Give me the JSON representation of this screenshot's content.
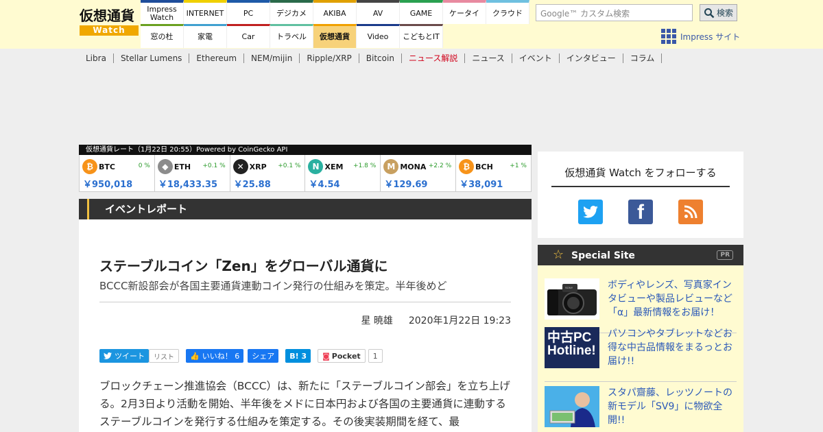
{
  "header": {
    "logo_top": "仮想通貨",
    "logo_bottom": "Watch",
    "nav_row1": [
      "Impress Watch",
      "INTERNET",
      "PC",
      "デジカメ",
      "AKIBA",
      "AV",
      "GAME",
      "ケータイ",
      "クラウド"
    ],
    "nav_row2": [
      "窓の杜",
      "家電",
      "Car",
      "トラベル",
      "仮想通貨",
      "Video",
      "こどもとIT"
    ],
    "nav_row1_colors": [
      "#1f4d9a",
      "#f0d000",
      "#1e5aa8",
      "#2a6a4a",
      "#e0a000",
      "#444444",
      "#2aa050",
      "#e88aa0",
      "#6fc0e0"
    ],
    "nav_row2_colors": [
      "#6aa020",
      "#40a0d0",
      "#c02020",
      "#60c0a0",
      "#f0a000",
      "#1a3a8a",
      "#6a4a4a"
    ],
    "search_placeholder": "Google™ カスタム検索",
    "search_button": "検索",
    "impress_site": "Impress サイト"
  },
  "subnav": [
    "Libra",
    "Stellar Lumens",
    "Ethereum",
    "NEM/mijin",
    "Ripple/XRP",
    "Bitcoin",
    "ニュース解説",
    "ニュース",
    "イベント",
    "インタビュー",
    "コラム"
  ],
  "ticker": {
    "heading": "仮想通貨レート（1月22日 20:55）Powered by CoinGecko API",
    "coins": [
      {
        "sym": "BTC",
        "chg": "0 %",
        "price": "￥950,018",
        "color": "#f7931a",
        "icon": "₿"
      },
      {
        "sym": "ETH",
        "chg": "+0.1 %",
        "price": "￥18,433.35",
        "color": "#8c8c8c",
        "icon": "◆"
      },
      {
        "sym": "XRP",
        "chg": "+0.1 %",
        "price": "￥25.88",
        "color": "#222222",
        "icon": "✕"
      },
      {
        "sym": "XEM",
        "chg": "+1.8 %",
        "price": "￥4.54",
        "color": "#2ab0a0",
        "icon": "N"
      },
      {
        "sym": "MONA",
        "chg": "+2.2 %",
        "price": "￥129.69",
        "color": "#c8a060",
        "icon": "M"
      },
      {
        "sym": "BCH",
        "chg": "+1 %",
        "price": "￥38,091",
        "color": "#f7931a",
        "icon": "₿"
      }
    ]
  },
  "category": "イベントレポート",
  "article": {
    "title": "ステーブルコイン「Zen」をグローバル通貨に",
    "subtitle": "BCCC新設部会が各国主要通貨連動コイン発行の仕組みを策定。半年後めど",
    "author": "星 暁雄",
    "date": "2020年1月22日 19:23",
    "share": {
      "tweet": "ツイート",
      "list": "リスト",
      "like": "いいね！ 6",
      "share": "シェア",
      "hatena": "B! 3",
      "pocket": "Pocket",
      "pocket_count": "1"
    },
    "body": "ブロックチェーン推進協会（BCCC）は、新たに「ステーブルコイン部会」を立ち上げる。2月3日より活動を開始、半年後をメドに日本円および各国の主要通貨に連動するステーブルコインを発行する仕組みを策定する。その後実装期間を経て、最"
  },
  "follow": {
    "heading": "仮想通貨 Watch をフォローする",
    "icons": [
      "twitter-icon",
      "facebook-icon",
      "rss-icon"
    ]
  },
  "special": {
    "heading": "Special Site",
    "pr": "PR",
    "items": [
      {
        "text": "ボディやレンズ、写真家インタビューや製品レビューなど「α」最新情報をお届け！"
      },
      {
        "text": "パソコンやタブレットなどお得な中古品情報をまるっとお届け!!",
        "thumb_text": "中古PC Hotline!"
      },
      {
        "text": "スタパ齋藤、レッツノートの新モデル「SV9」に物欲全開!!"
      }
    ]
  }
}
